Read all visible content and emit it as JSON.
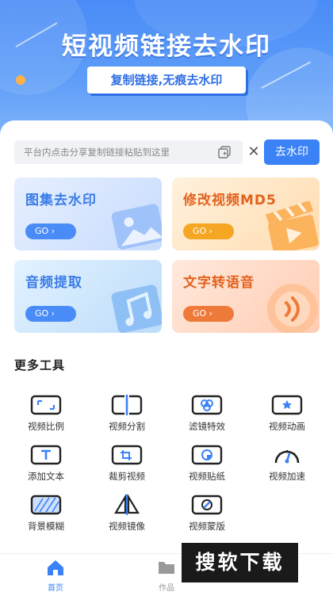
{
  "hero": {
    "title": "短视频链接去水印",
    "subtitle": "复制链接,无痕去水印"
  },
  "search": {
    "placeholder": "平台内点击分享复制链接粘贴到这里",
    "clear_symbol": "✕",
    "action_label": "去水印"
  },
  "cards": [
    {
      "title": "图集去水印",
      "go_label": "GO ›",
      "title_color": "#3a7ce8",
      "btn_color": "#4a8cf7"
    },
    {
      "title": "修改视频MD5",
      "go_label": "GO ›",
      "title_color": "#e2621d",
      "btn_color": "#f5a623"
    },
    {
      "title": "音频提取",
      "go_label": "GO ›",
      "title_color": "#3a7ce8",
      "btn_color": "#4a8cf7"
    },
    {
      "title": "文字转语音",
      "go_label": "GO ›",
      "title_color": "#e2621d",
      "btn_color": "#ee7a3a"
    }
  ],
  "tools": {
    "heading": "更多工具",
    "items": [
      {
        "label": "视频比例",
        "icon": "aspect-ratio-icon"
      },
      {
        "label": "视频分割",
        "icon": "split-icon"
      },
      {
        "label": "滤镜特效",
        "icon": "filter-icon"
      },
      {
        "label": "视频动画",
        "icon": "animation-icon"
      },
      {
        "label": "添加文本",
        "icon": "text-icon"
      },
      {
        "label": "裁剪视频",
        "icon": "crop-icon"
      },
      {
        "label": "视频贴纸",
        "icon": "sticker-icon"
      },
      {
        "label": "视频加速",
        "icon": "speedometer-icon"
      },
      {
        "label": "背景模糊",
        "icon": "blur-icon"
      },
      {
        "label": "视频镜像",
        "icon": "mirror-icon"
      },
      {
        "label": "视频蒙版",
        "icon": "mask-icon"
      }
    ]
  },
  "tabbar": {
    "items": [
      {
        "label": "首页",
        "active": true,
        "icon": "home-icon"
      },
      {
        "label": "作品",
        "active": false,
        "icon": "folder-icon"
      }
    ]
  },
  "watermark": {
    "text": "搜软下载"
  },
  "colors": {
    "accent": "#3a82f6",
    "active_tab": "#3a82f6",
    "inactive_tab": "#999999"
  }
}
